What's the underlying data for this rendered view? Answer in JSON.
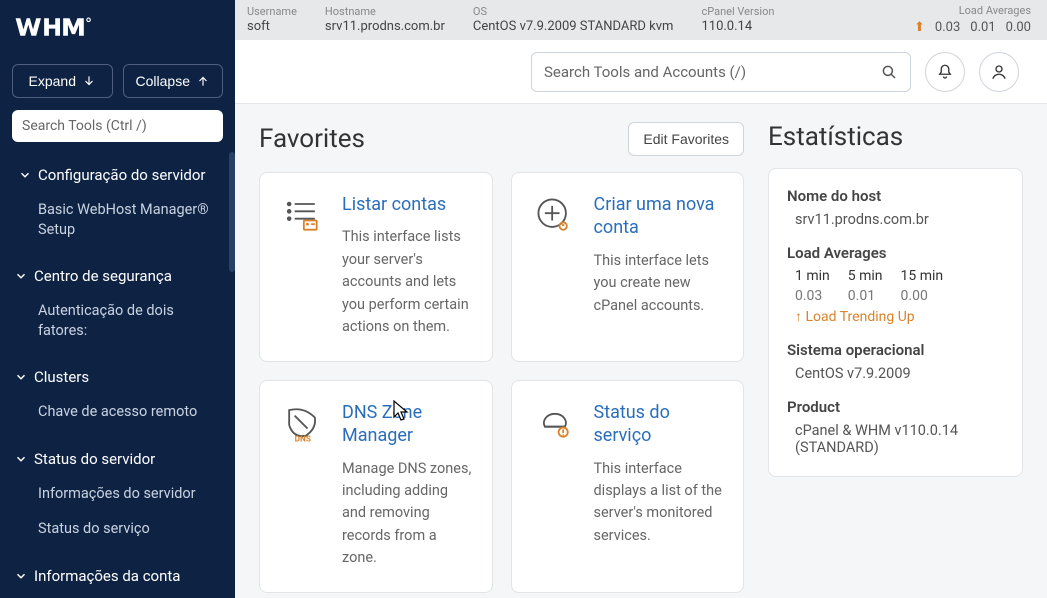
{
  "logo_alt": "WHM",
  "sidebar": {
    "expand": "Expand",
    "collapse": "Collapse",
    "search_placeholder": "Search Tools (Ctrl /)",
    "groups": [
      {
        "label": "Configuração do servidor",
        "open": true,
        "items": [
          "Basic WebHost Manager® Setup"
        ]
      },
      {
        "label": "Centro de segurança",
        "open": true,
        "items": [
          "Autenticação de dois fatores:"
        ]
      },
      {
        "label": "Clusters",
        "open": true,
        "items": [
          "Chave de acesso remoto"
        ]
      },
      {
        "label": "Status do servidor",
        "open": true,
        "items": [
          "Informações do servidor",
          "Status do serviço"
        ]
      },
      {
        "label": "Informações da conta",
        "open": true,
        "items": []
      }
    ]
  },
  "topinfo": {
    "username_lbl": "Username",
    "username": "soft",
    "hostname_lbl": "Hostname",
    "hostname": "srv11.prodns.com.br",
    "os_lbl": "OS",
    "os": "CentOS v7.9.2009 STANDARD kvm",
    "cpver_lbl": "cPanel Version",
    "cpver": "110.0.14",
    "la_lbl": "Load Averages",
    "la1": "0.03",
    "la5": "0.01",
    "la15": "0.00"
  },
  "toolbar": {
    "search_placeholder": "Search Tools and Accounts (/)"
  },
  "favorites": {
    "title": "Favorites",
    "edit": "Edit Favorites",
    "cards": [
      {
        "title": "Listar contas",
        "desc": "This interface lists your server's accounts and lets you perform certain actions on them."
      },
      {
        "title": "Criar uma nova conta",
        "desc": "This interface lets you create new cPanel accounts."
      },
      {
        "title": "DNS Zone Manager",
        "desc": "Manage DNS zones, including adding and removing records from a zone."
      },
      {
        "title": "Status do serviço",
        "desc": "This interface displays a list of the server's monitored services."
      }
    ]
  },
  "stats": {
    "title": "Estatísticas",
    "hostname_lbl": "Nome do host",
    "hostname": "srv11.prodns.com.br",
    "la_lbl": "Load Averages",
    "la_cols": {
      "c1": "1 min",
      "c2": "5 min",
      "c3": "15 min"
    },
    "la_vals": {
      "v1": "0.03",
      "v2": "0.01",
      "v3": "0.00"
    },
    "trend": "Load Trending Up",
    "os_lbl": "Sistema operacional",
    "os": "CentOS v7.9.2009",
    "product_lbl": "Product",
    "product": "cPanel & WHM v110.0.14 (STANDARD)"
  }
}
